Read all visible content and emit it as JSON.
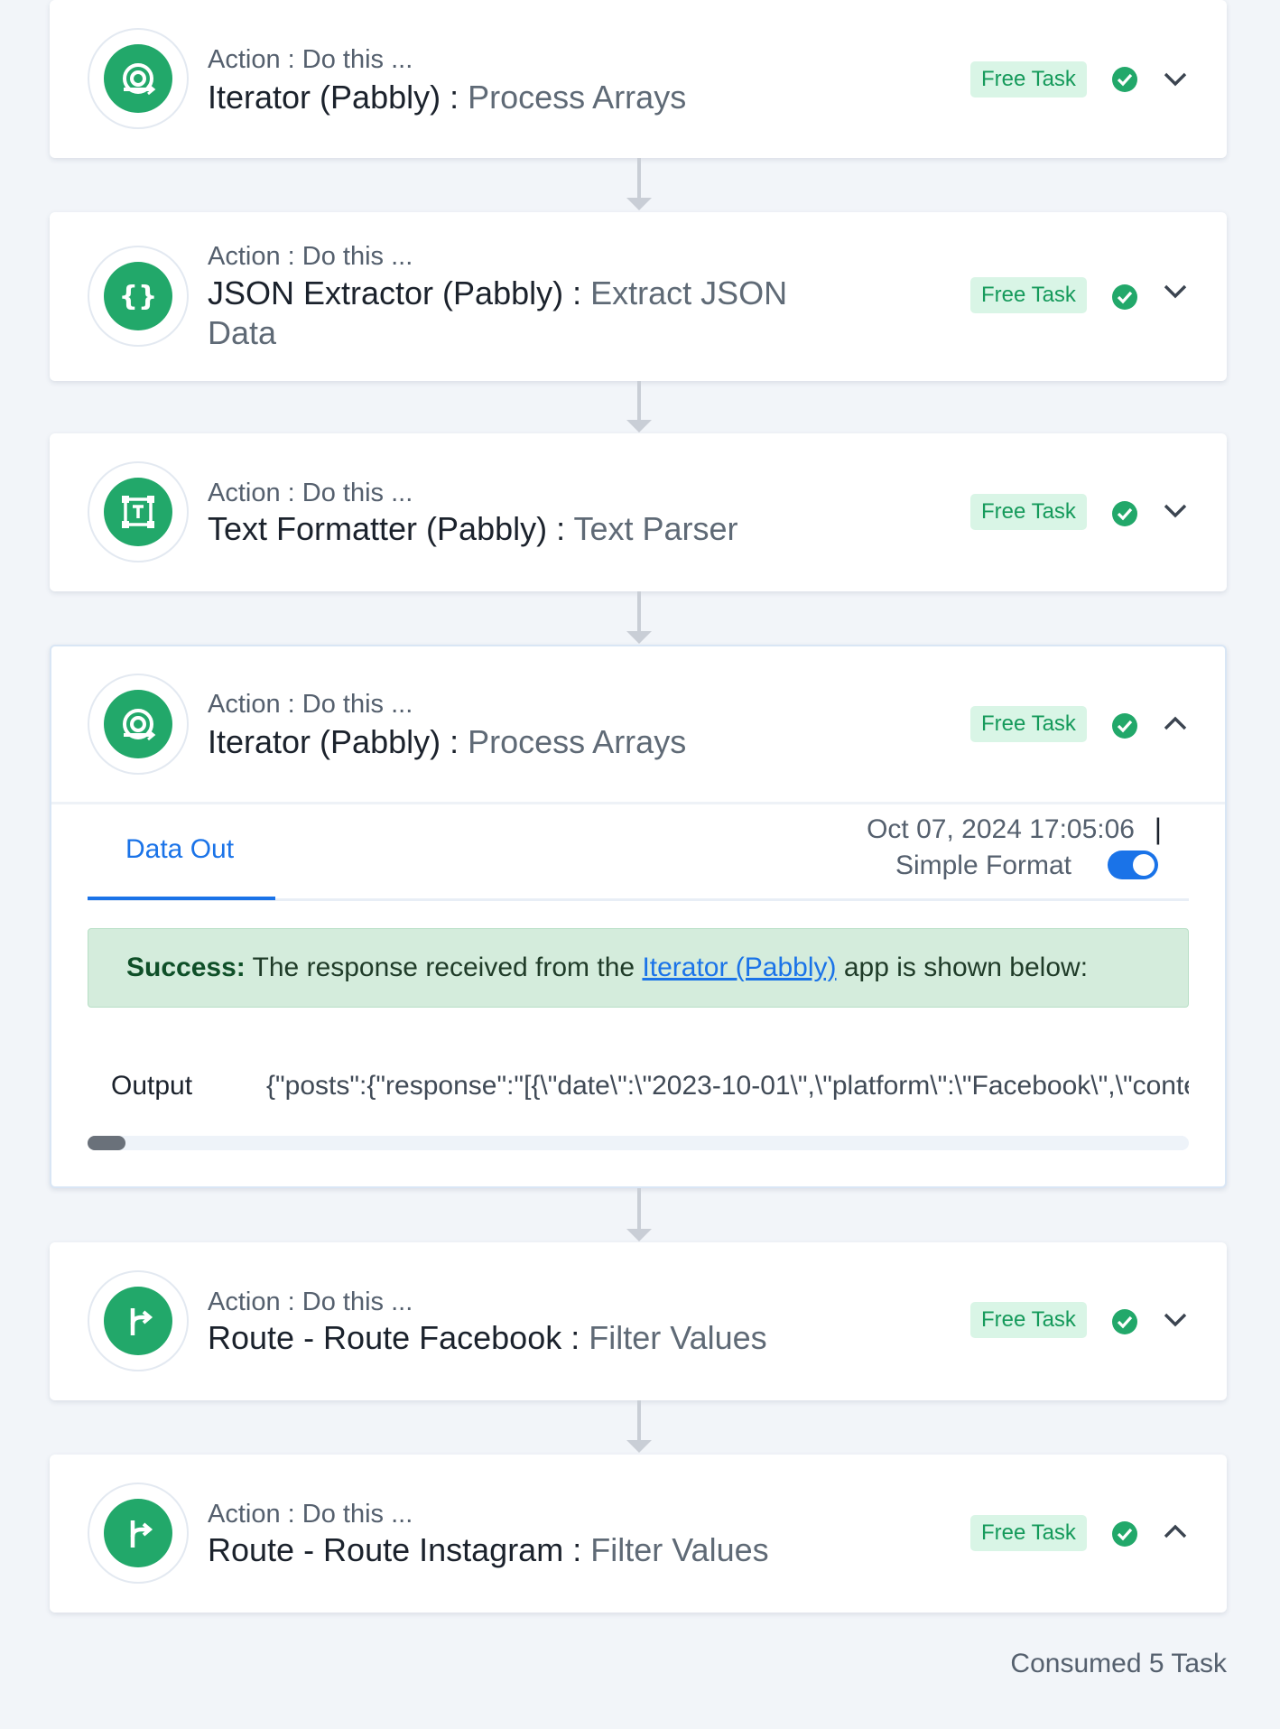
{
  "steps": [
    {
      "subtitle": "Action : Do this ...",
      "app": "Iterator (Pabbly) :",
      "action": "Process Arrays",
      "badge": "Free Task",
      "icon": "iterator-icon"
    },
    {
      "subtitle": "Action : Do this ...",
      "app": "JSON Extractor (Pabbly) :",
      "action": "Extract JSON Data",
      "badge": "Free Task",
      "icon": "json-braces-icon"
    },
    {
      "subtitle": "Action : Do this ...",
      "app": "Text Formatter (Pabbly) :",
      "action": "Text Parser",
      "badge": "Free Task",
      "icon": "text-formatter-icon"
    },
    {
      "subtitle": "Action : Do this ...",
      "app": "Iterator (Pabbly) :",
      "action": "Process Arrays",
      "badge": "Free Task",
      "icon": "iterator-icon"
    },
    {
      "subtitle": "Action : Do this ...",
      "app": "Route - Route Facebook :",
      "action": "Filter Values",
      "badge": "Free Task",
      "icon": "route-icon"
    },
    {
      "subtitle": "Action : Do this ...",
      "app": "Route - Route Instagram :",
      "action": "Filter Values",
      "badge": "Free Task",
      "icon": "route-icon"
    }
  ],
  "expanded": {
    "tab": "Data Out",
    "timestamp": "Oct 07, 2024 17:05:06",
    "separator": "|",
    "format_label": "Simple Format",
    "format_on": true,
    "alert_strong": "Success:",
    "alert_pre": " The response received from the ",
    "alert_link": "Iterator (Pabbly)",
    "alert_post": " app is shown below:",
    "output_label": "Output",
    "output_value": "{\"posts\":{\"response\":\"[{\\\"date\\\":\\\"2023-10-01\\\",\\\"platform\\\":\\\"Facebook\\\",\\\"content\\\""
  },
  "footer": {
    "consumed": "Consumed 5 Task"
  },
  "colors": {
    "accent": "#1a73e8",
    "success": "#22a86a",
    "badge_bg": "#d9f5e6"
  }
}
